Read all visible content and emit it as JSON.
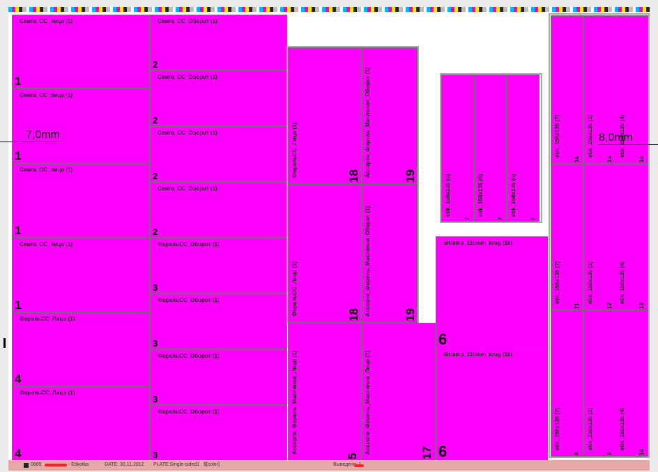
{
  "dimensions": {
    "left": "7,0mm",
    "right": "8,0mm"
  },
  "col1": [
    {
      "name": "Семга_СС_лицо (1)",
      "num": "1"
    },
    {
      "name": "Семга_СС_лицо (1)",
      "num": "1"
    },
    {
      "name": "Семга_СС_лицо (1)",
      "num": "1"
    },
    {
      "name": "Семга_СС_лицо (1)",
      "num": "1"
    },
    {
      "name": "ФорельСС_Лицо (1)",
      "num": "4"
    },
    {
      "name": "ФорельСС_Лицо (1)",
      "num": "4"
    }
  ],
  "col2": [
    {
      "name": "Семга_СС_Оборот (1)",
      "num": "2"
    },
    {
      "name": "Семга_СС_Оборот (1)",
      "num": "2"
    },
    {
      "name": "Семга_СС_Оборот (1)",
      "num": "2"
    },
    {
      "name": "Семга_СС_Оборот (1)",
      "num": "2"
    },
    {
      "name": "ФорельСС_Оборот (1)",
      "num": "3"
    },
    {
      "name": "ФорельСС_Оборот (1)",
      "num": "3"
    },
    {
      "name": "ФорельСС_Оборот (1)",
      "num": "3"
    },
    {
      "name": "ФорельСС_Оборот (1)",
      "num": "3"
    }
  ],
  "group18": [
    {
      "name": "ФорельСС_Лицо (1)",
      "num": "18"
    },
    {
      "name": "Ассорти_Форель_Масляная_Оборот (1)",
      "num": "19"
    },
    {
      "name": "ФорельСС_Лицо (1)",
      "num": "18"
    },
    {
      "name": "Ассорти_Форель_Масляная_Оборот (1)",
      "num": "19"
    }
  ],
  "bottom_mid": [
    {
      "name": "Ассорти_Форель_Масляная_Лицо (1)",
      "num": "5"
    },
    {
      "name": "Ассорти_Форель_Масляная_Лицо (1)",
      "num": "17"
    }
  ],
  "small_group": [
    {
      "name": "etik_158x135 (6)",
      "num": "7"
    },
    {
      "name": "etik_158x135 (6)",
      "num": "7"
    },
    {
      "name": "etik_158x135 (6)",
      "num": "7"
    }
  ],
  "shtamp": [
    {
      "name": "Shtamp_110mm_krug (18)",
      "num": "6"
    },
    {
      "name": "Shtamp_110mm_krug (18)",
      "num": "6"
    }
  ],
  "right_group": [
    {
      "name": "etik_158x135 (7)",
      "num": "14"
    },
    {
      "name": "etik_158x135 (1)",
      "num": "15"
    },
    {
      "name": "etik_158x135 (4)",
      "num": "16"
    },
    {
      "name": "etik_158x135 (7)",
      "num": "11"
    },
    {
      "name": "etik_158x135 (1)",
      "num": "12"
    },
    {
      "name": "etik_158x135 (4)",
      "num": "13"
    },
    {
      "name": "etik_158x135 (7)",
      "num": "8"
    },
    {
      "name": "etik_158x135 (1)",
      "num": "9"
    },
    {
      "name": "etik_158x135 (4)",
      "num": "10"
    }
  ],
  "footer": {
    "job": "0889",
    "product": "- Etikotka",
    "date": "DATE: 30.11.2012",
    "plate": "PLATE:Single-sided1",
    "color": "$[color]",
    "output": "Выведено: 1"
  },
  "colors": {
    "label": "#ff00ff",
    "border": "#6e6e6e",
    "sheet": "#ffffff",
    "footer": "#e6a8a8"
  }
}
